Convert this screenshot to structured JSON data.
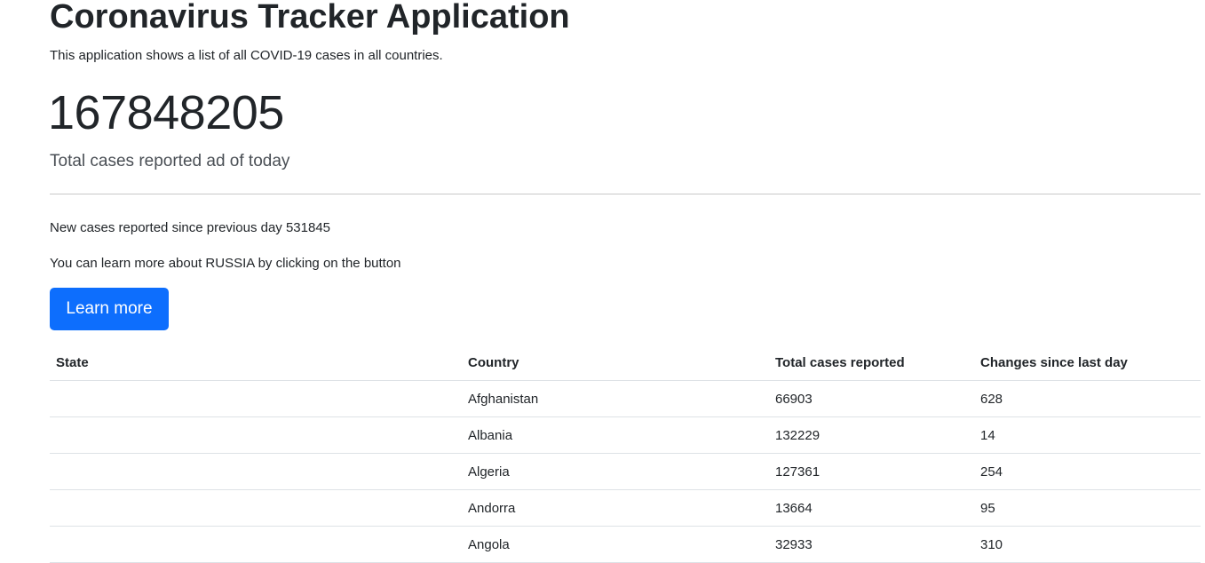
{
  "header": {
    "title": "Coronavirus Tracker Application",
    "subtitle": "This application shows a list of all COVID-19 cases in all countries."
  },
  "summary": {
    "total_cases": "167848205",
    "total_label": "Total cases reported ad of today",
    "new_cases_text": "New cases reported since previous day 531845",
    "learn_more_text": "You can learn more about RUSSIA by clicking on the button",
    "button_label": "Learn more"
  },
  "table": {
    "headers": [
      "State",
      "Country",
      "Total cases reported",
      "Changes since last day"
    ],
    "rows": [
      [
        "",
        "Afghanistan",
        "66903",
        "628"
      ],
      [
        "",
        "Albania",
        "132229",
        "14"
      ],
      [
        "",
        "Algeria",
        "127361",
        "254"
      ],
      [
        "",
        "Andorra",
        "13664",
        "95"
      ],
      [
        "",
        "Angola",
        "32933",
        "310"
      ]
    ]
  },
  "colors": {
    "button_bg": "#0d6efd",
    "button_text": "#ffffff",
    "text": "#212529",
    "divider": "#c8c8c8"
  }
}
